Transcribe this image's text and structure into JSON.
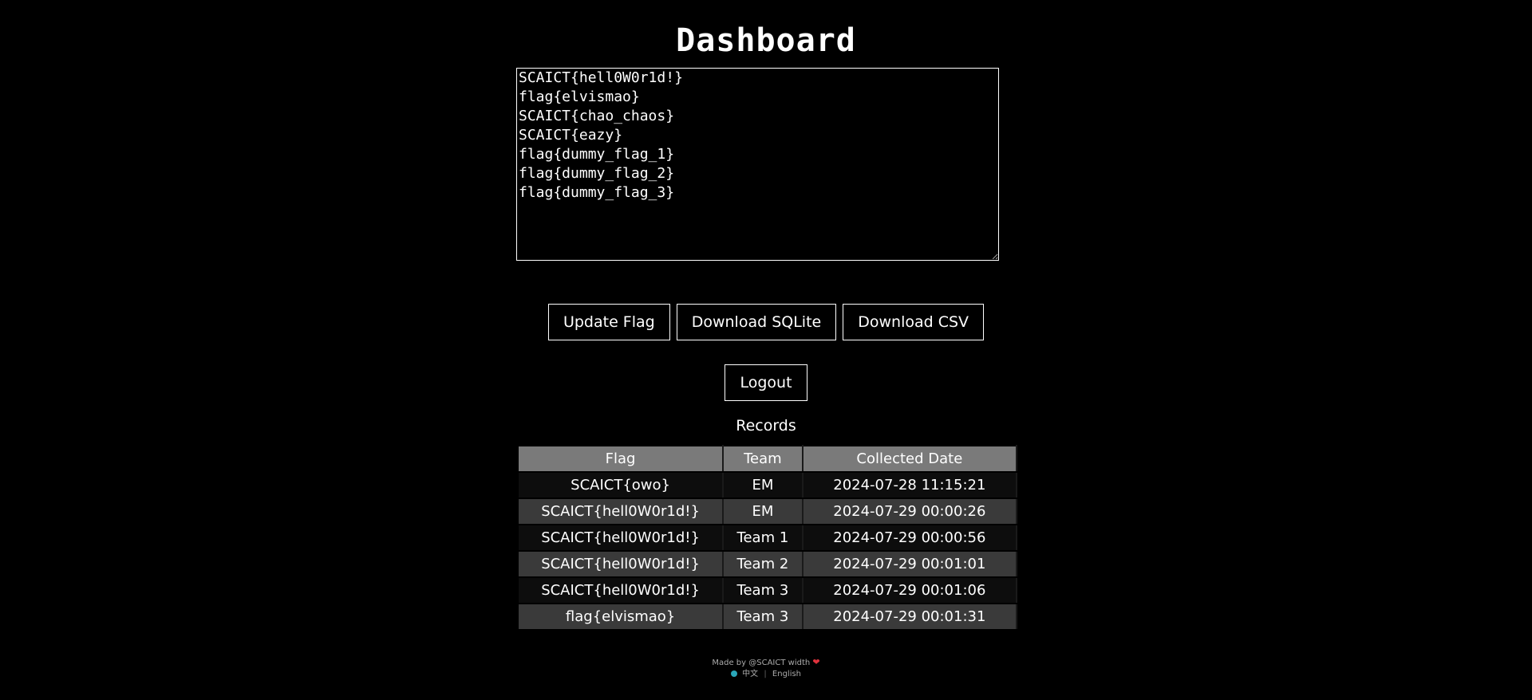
{
  "header": {
    "title": "Dashboard"
  },
  "flags_editor": {
    "value": "SCAICT{hell0W0r1d!}\nflag{elvismao}\nSCAICT{chao_chaos}\nSCAICT{eazy}\nflag{dummy_flag_1}\nflag{dummy_flag_2}\nflag{dummy_flag_3}"
  },
  "actions": {
    "update_flag": "Update Flag",
    "download_sqlite": "Download SQLite",
    "download_csv": "Download CSV",
    "logout": "Logout"
  },
  "records": {
    "label": "Records",
    "columns": [
      "Flag",
      "Team",
      "Collected Date"
    ],
    "rows": [
      [
        "SCAICT{owo}",
        "EM",
        "2024-07-28 11:15:21"
      ],
      [
        "SCAICT{hell0W0r1d!}",
        "EM",
        "2024-07-29 00:00:26"
      ],
      [
        "SCAICT{hell0W0r1d!}",
        "Team 1",
        "2024-07-29 00:00:56"
      ],
      [
        "SCAICT{hell0W0r1d!}",
        "Team 2",
        "2024-07-29 00:01:01"
      ],
      [
        "SCAICT{hell0W0r1d!}",
        "Team 3",
        "2024-07-29 00:01:06"
      ],
      [
        "flag{elvismao}",
        "Team 3",
        "2024-07-29 00:01:31"
      ]
    ]
  },
  "footer": {
    "made_by": "Made by @SCAICT width",
    "heart_icon": "heart-icon",
    "globe_icon": "globe-icon",
    "lang_zh": "中文",
    "lang_sep": "|",
    "lang_en": "English"
  },
  "colors": {
    "background": "#000000",
    "header_row": "#7a7a7a",
    "row_dark": "#0d0d0d",
    "row_light": "#3a3a3a",
    "heart": "#e0323c"
  }
}
